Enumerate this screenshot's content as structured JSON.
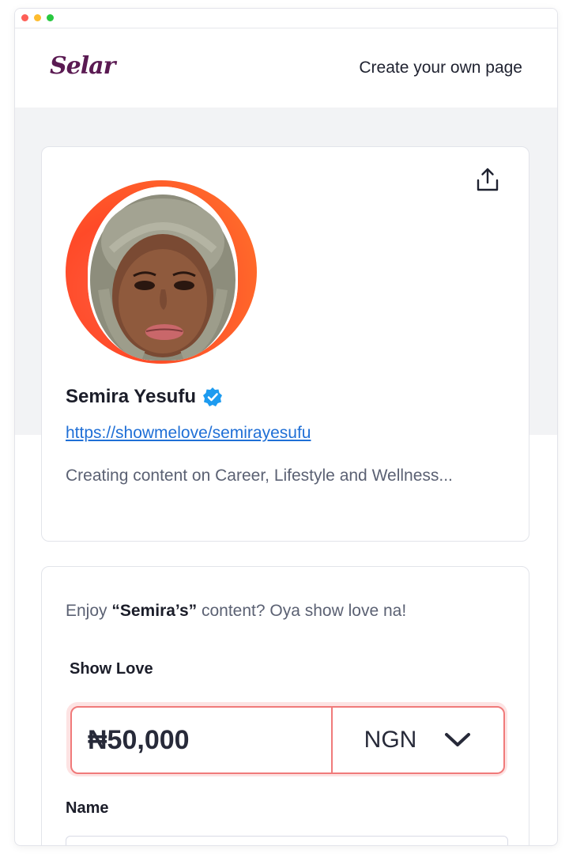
{
  "colors": {
    "brand_logo": "#5a1a52",
    "link": "#1f6fd6",
    "accent_error": "#f07a7a",
    "avatar_ring": "#ff5a3c",
    "verified": "#1d9bf0",
    "dot_red": "#fe5f57",
    "dot_yellow": "#febc2e",
    "dot_green": "#28c840"
  },
  "header": {
    "logo_text": "Selar",
    "create_link": "Create your own page"
  },
  "profile": {
    "name": "Semira Yesufu",
    "url": "https://showmelove/semirayesufu",
    "bio": "Creating content on Career, Lifestyle and Wellness..."
  },
  "support": {
    "enjoy_prefix": "Enjoy ",
    "enjoy_name": "“Semira’s”",
    "enjoy_suffix": " content? Oya show love na!",
    "show_love_label": "Show Love",
    "amount_value": "₦50,000",
    "currency": "NGN",
    "name_label": "Name"
  },
  "icons": {
    "share": "share-icon",
    "verified": "verified-badge-icon",
    "chevron": "chevron-down-icon"
  }
}
